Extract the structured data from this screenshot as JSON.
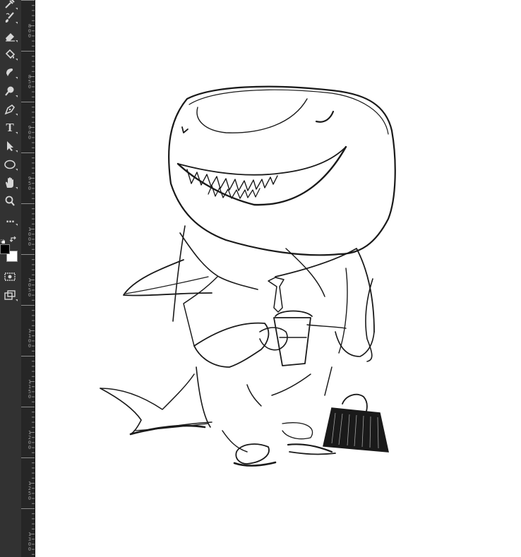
{
  "toolbar": {
    "tools": [
      {
        "icon": "eyedropper-icon"
      },
      {
        "icon": "brush-icon"
      },
      {
        "icon": "eraser-icon"
      },
      {
        "icon": "paint-bucket-icon"
      },
      {
        "icon": "smudge-icon"
      },
      {
        "icon": "dodge-icon"
      },
      {
        "icon": "pen-icon"
      },
      {
        "icon": "type-icon",
        "label": "T"
      },
      {
        "icon": "path-selection-icon"
      },
      {
        "icon": "ellipse-icon"
      },
      {
        "icon": "hand-icon"
      },
      {
        "icon": "zoom-icon"
      },
      {
        "icon": "more-tools-icon",
        "label": "..."
      }
    ],
    "foreground_color": "#000000",
    "background_color": "#ffffff"
  },
  "ruler": {
    "labels": [
      "800",
      "850",
      "900",
      "950",
      "1000",
      "1050",
      "1100",
      "1150",
      "1200",
      "1250",
      "1300"
    ]
  },
  "colors": {
    "toolbar_bg": "#323232",
    "ruler_bg": "#262626",
    "canvas_bg": "#ffffff",
    "ink": "#1a1a1a"
  }
}
